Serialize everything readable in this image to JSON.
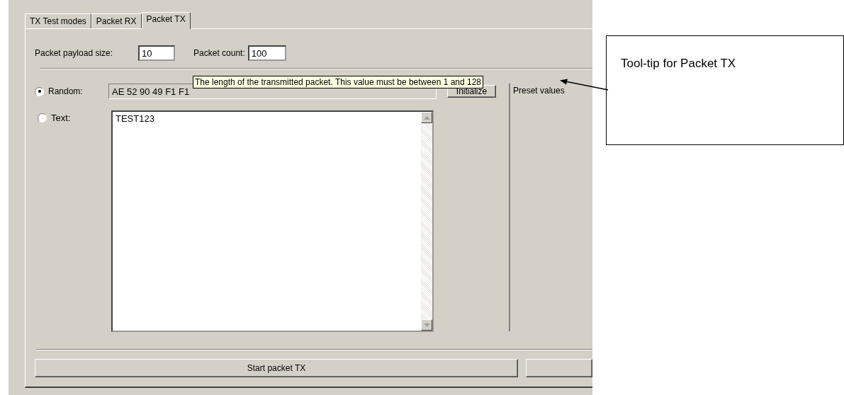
{
  "tabs": [
    {
      "label": "TX Test modes",
      "selected": false
    },
    {
      "label": "Packet RX",
      "selected": false
    },
    {
      "label": "Packet TX",
      "selected": true
    }
  ],
  "payload_size": {
    "label": "Packet payload size:",
    "value": "10"
  },
  "packet_count": {
    "label": "Packet count:",
    "value": "100"
  },
  "modes": [
    {
      "label": "Random:",
      "selected": true,
      "kind": "line",
      "value": "AE 52 90 49 F1 F1"
    },
    {
      "label": "Text:",
      "selected": false,
      "kind": "area",
      "value": "TEST123"
    }
  ],
  "initialize_button": "Initialize",
  "preset_group": {
    "title": "Preset values"
  },
  "start_button": "Start packet TX",
  "tooltip": "The length of the transmitted packet. This value must be between 1 and 128",
  "callout": "Tool-tip for Packet TX"
}
